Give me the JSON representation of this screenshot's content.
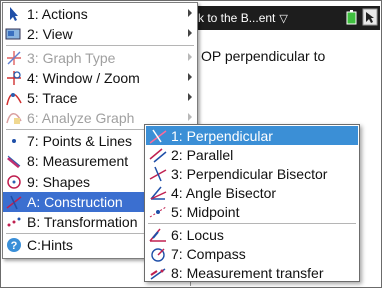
{
  "document": {
    "tab_title": "k to the B...ent",
    "text": "OP perpendicular to"
  },
  "main_menu": {
    "items": [
      {
        "label": "1: Actions",
        "icon": "cursor-arrow-icon"
      },
      {
        "label": "2: View",
        "icon": "view-icon"
      },
      {
        "label": "3: Graph Type",
        "icon": "graph-type-icon",
        "disabled": true
      },
      {
        "label": "4: Window / Zoom",
        "icon": "window-zoom-icon"
      },
      {
        "label": "5: Trace",
        "icon": "trace-icon"
      },
      {
        "label": "6: Analyze Graph",
        "icon": "analyze-graph-icon",
        "disabled": true
      },
      {
        "label": "7: Points & Lines",
        "icon": "points-lines-icon"
      },
      {
        "label": "8: Measurement",
        "icon": "measurement-icon"
      },
      {
        "label": "9: Shapes",
        "icon": "shapes-icon"
      },
      {
        "label": "A: Construction",
        "icon": "construction-icon",
        "selected": true
      },
      {
        "label": "B: Transformation",
        "icon": "transformation-icon"
      },
      {
        "label": "C:Hints",
        "icon": "hints-icon"
      }
    ]
  },
  "sub_menu": {
    "items": [
      {
        "label": "1: Perpendicular",
        "icon": "perpendicular-icon",
        "selected": true
      },
      {
        "label": "2: Parallel",
        "icon": "parallel-icon"
      },
      {
        "label": "3: Perpendicular Bisector",
        "icon": "perpendicular-bisector-icon"
      },
      {
        "label": "4: Angle Bisector",
        "icon": "angle-bisector-icon"
      },
      {
        "label": "5: Midpoint",
        "icon": "midpoint-icon"
      },
      {
        "label": "6: Locus",
        "icon": "locus-icon"
      },
      {
        "label": "7: Compass",
        "icon": "compass-icon"
      },
      {
        "label": "8: Measurement transfer",
        "icon": "measurement-transfer-icon"
      }
    ]
  },
  "colors": {
    "menu_highlight": "#3b6fd0",
    "submenu_highlight": "#3b8fd6",
    "header_bg": "#1d1d1d"
  }
}
